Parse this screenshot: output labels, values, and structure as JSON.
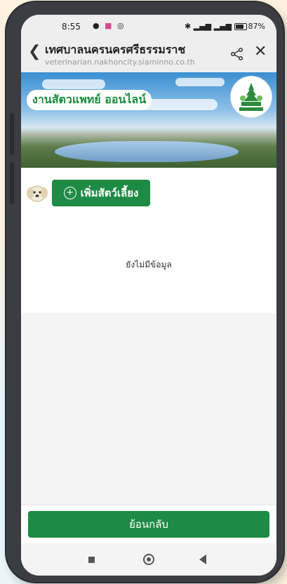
{
  "status_bar": {
    "time": "8:55",
    "battery": "87"
  },
  "header": {
    "title": "เทศบาลนครนครศรีธรรมราช",
    "url": "veterinarian.nakhoncity.siaminno.co.th"
  },
  "banner": {
    "title": "งานสัตวแพทย์ ออนไลน์"
  },
  "main": {
    "add_pet_label": "เพิ่มสัตว์เลี้ยง",
    "empty_text": "ยังไม่มีข้อมูล"
  },
  "footer": {
    "back_label": "ย้อนกลับ"
  },
  "colors": {
    "primary": "#1d8b44"
  }
}
